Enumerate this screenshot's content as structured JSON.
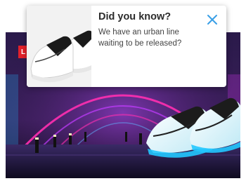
{
  "popup": {
    "title": "Did you know?",
    "message": "We have an urban line waiting to be released?",
    "close_icon": "close-icon"
  },
  "hero": {
    "badge_label": "L",
    "image": "sneaker-tunnel-neon-image"
  },
  "colors": {
    "accent_close": "#3aa0e6",
    "badge_red": "#e2202a",
    "neon_pink": "#ff2fb0",
    "neon_blue": "#22c8ff"
  }
}
